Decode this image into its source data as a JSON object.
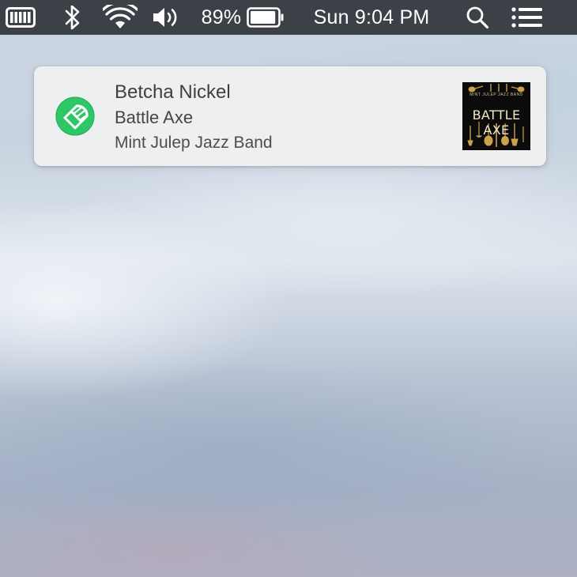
{
  "menubar": {
    "battery_percent_label": "89%",
    "battery_level": 0.89,
    "clock": "Sun 9:04 PM",
    "icons": [
      "app-status-icon",
      "bluetooth-icon",
      "wifi-icon",
      "volume-icon",
      "battery-icon",
      "spotlight-search-icon",
      "notification-center-icon"
    ]
  },
  "notification": {
    "title": "Betcha Nickel",
    "subtitle": "Battle Axe",
    "body": "Mint Julep Jazz Band",
    "app_icon": "spotify-speaker-icon",
    "album_art": {
      "title_text": "BATTLE AXE",
      "small_text": "MINT JULEP JAZZ BAND"
    }
  },
  "colors": {
    "menubar_bg": "#3c4047",
    "app_icon_green": "#2ec766",
    "notification_bg": "#eeeff0",
    "album_gold": "#c9a24a"
  }
}
